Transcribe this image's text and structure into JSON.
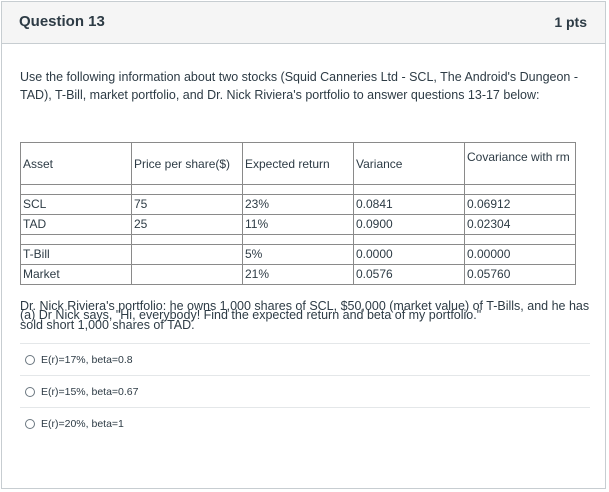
{
  "question": {
    "title": "Question 13",
    "points": "1 pts"
  },
  "intro": "Use the following information about two stocks (Squid Canneries Ltd - SCL, The Android's Dungeon - TAD), T-Bill, market portfolio, and Dr. Nick Riviera's portfolio to answer questions 13-17 below:",
  "table": {
    "headers": [
      "Asset",
      "Price per share($)",
      "Expected return",
      "Variance",
      "Covariance with rm"
    ],
    "rows": [
      [
        "SCL",
        "75",
        "23%",
        "0.0841",
        "0.06912"
      ],
      [
        "TAD",
        "25",
        "11%",
        "0.0900",
        "0.02304"
      ],
      [
        "T-Bill",
        "",
        "5%",
        "0.0000",
        "0.00000"
      ],
      [
        "Market",
        "",
        "21%",
        "0.0576",
        "0.05760"
      ]
    ]
  },
  "portfolio_text": "Dr. Nick Riviera's portfolio: he owns 1,000 shares of SCL, $50,000 (market value) of T-Bills, and he has sold short 1,000 shares of TAD.",
  "prompt": "(a) Dr Nick says, \"Hi, everybody! Find the expected return and beta of my portfolio.\"",
  "answers": [
    "E(r)=17%, beta=0.8",
    "E(r)=15%, beta=0.67",
    "E(r)=20%, beta=1"
  ]
}
